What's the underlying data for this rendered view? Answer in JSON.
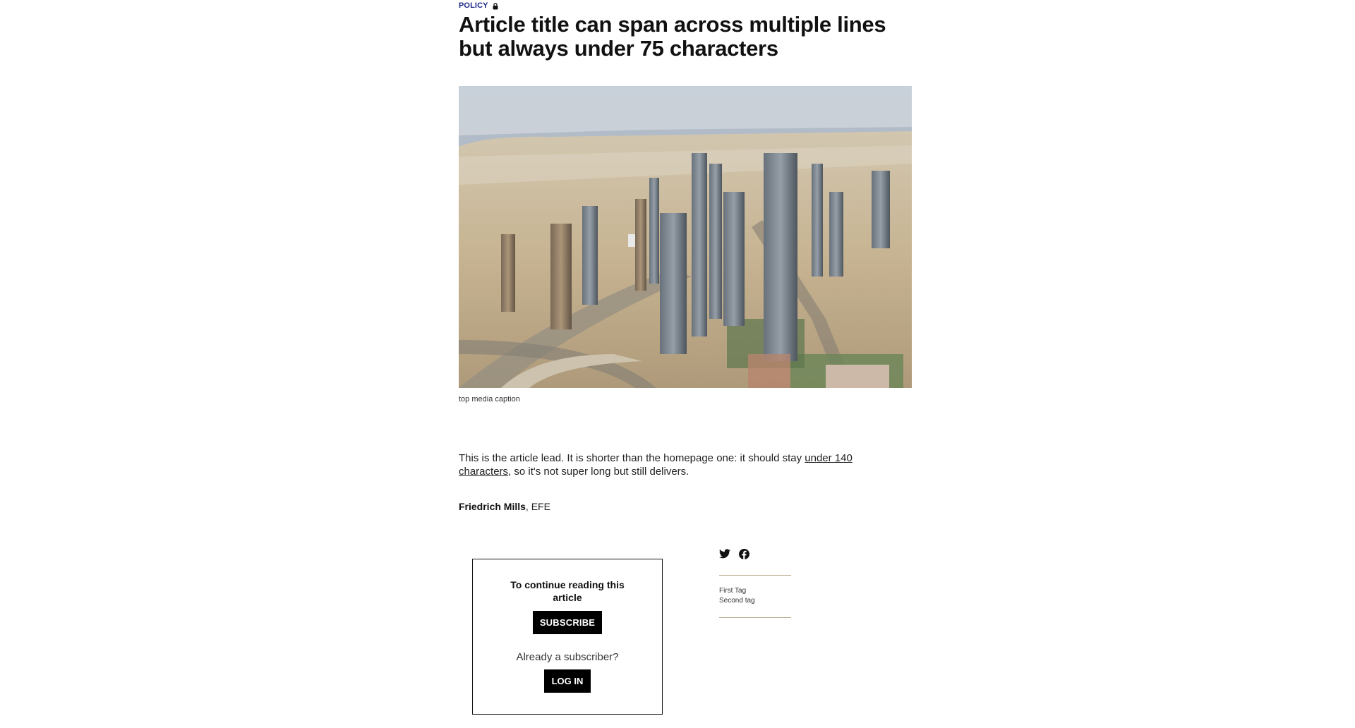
{
  "section": {
    "label": "POLICY",
    "lock_icon": "lock-icon"
  },
  "article": {
    "title": "Article title can span across multiple lines but always under 75 characters",
    "media_caption": "top media caption",
    "lead_before": "This is the article lead. It is shorter than the homepage one: it should stay ",
    "lead_link": "under 140 characters",
    "lead_after": ", so it's not super long but still delivers.",
    "author": "Friedrich Mills",
    "agency": ", EFE"
  },
  "paywall": {
    "heading": "To continue reading this article",
    "subscribe_label": "SUBSCRIBE",
    "already_text": "Already a subscriber?",
    "login_label": "LOG IN"
  },
  "share": {
    "icons": [
      "twitter-icon",
      "facebook-icon"
    ]
  },
  "tags": [
    "First Tag",
    "Second tag"
  ],
  "colors": {
    "section_accent": "#1d2b8c",
    "tag_rule": "#b8a88a",
    "button_bg": "#000000"
  }
}
